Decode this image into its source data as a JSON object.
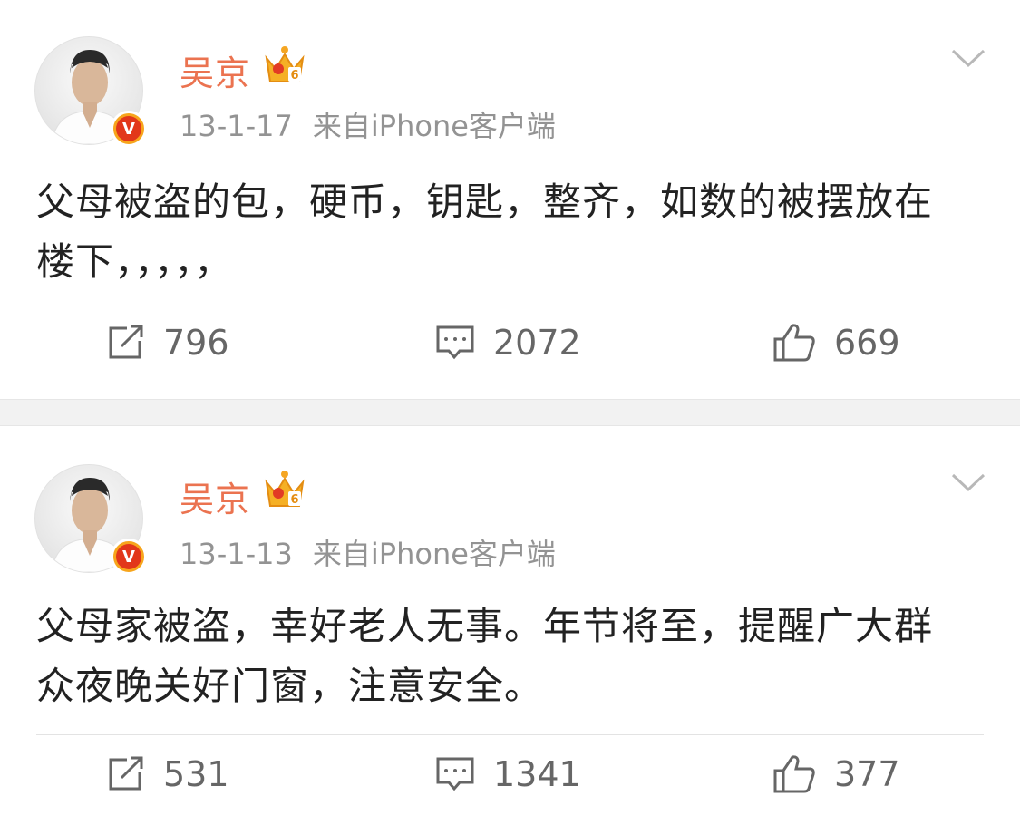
{
  "posts": [
    {
      "author": "吴京",
      "date": "13-1-17",
      "source": "来自iPhone客户端",
      "text_lines": [
        "父母被盗的包，硬币，钥匙，整齐，如数的被摆放在",
        "楼下，，，，，"
      ],
      "reposts": "796",
      "comments": "2072",
      "likes": "669"
    },
    {
      "author": "吴京",
      "date": "13-1-13",
      "source": "来自iPhone客户端",
      "text_lines": [
        "父母家被盗，幸好老人无事。年节将至，提醒广大群",
        "众夜晚关好门窗，注意安全。"
      ],
      "reposts": "531",
      "comments": "1341",
      "likes": "377"
    }
  ],
  "badges": {
    "verified": "V",
    "member_level": "6"
  },
  "colors": {
    "name": "#eb7350",
    "meta": "#939393",
    "text": "#222222",
    "action": "#666666",
    "badge": "#f7a51c"
  },
  "icons": [
    "avatar",
    "verified-badge",
    "crown-icon",
    "chevron-down-icon",
    "repost-icon",
    "comment-icon",
    "like-icon"
  ]
}
